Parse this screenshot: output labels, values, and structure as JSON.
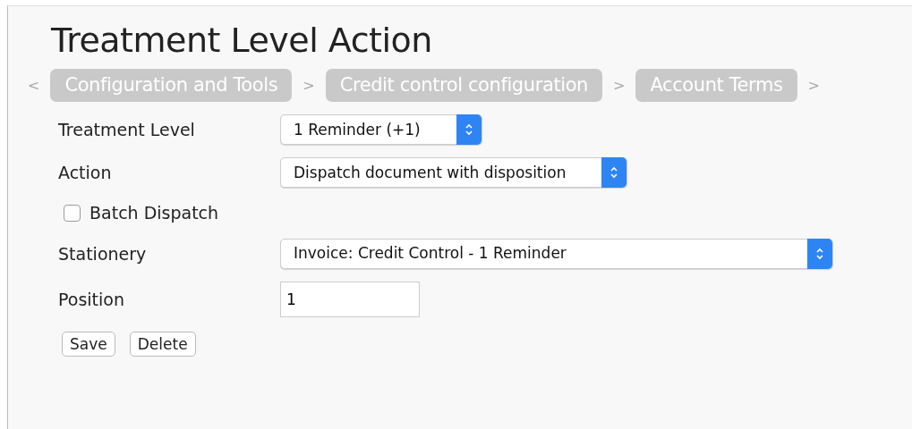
{
  "title": "Treatment Level Action",
  "breadcrumb": {
    "lead": "<",
    "items": [
      {
        "label": "Configuration and Tools",
        "separator": ">"
      },
      {
        "label": "Credit control configuration",
        "separator": ">"
      },
      {
        "label": "Account Terms",
        "separator": ">"
      }
    ]
  },
  "fields": [
    {
      "kind": "select",
      "label": "Treatment Level",
      "value": "1 Reminder (+1)",
      "wide": false
    },
    {
      "kind": "select",
      "label": "Action",
      "value": "Dispatch document with disposition",
      "wide": false
    },
    {
      "kind": "checkbox",
      "label": "Batch Dispatch",
      "checked": false
    },
    {
      "kind": "select",
      "label": "Stationery",
      "value": "Invoice: Credit Control - 1 Reminder",
      "wide": true
    },
    {
      "kind": "text",
      "label": "Position",
      "value": "1"
    }
  ],
  "buttons": [
    "Save",
    "Delete"
  ]
}
